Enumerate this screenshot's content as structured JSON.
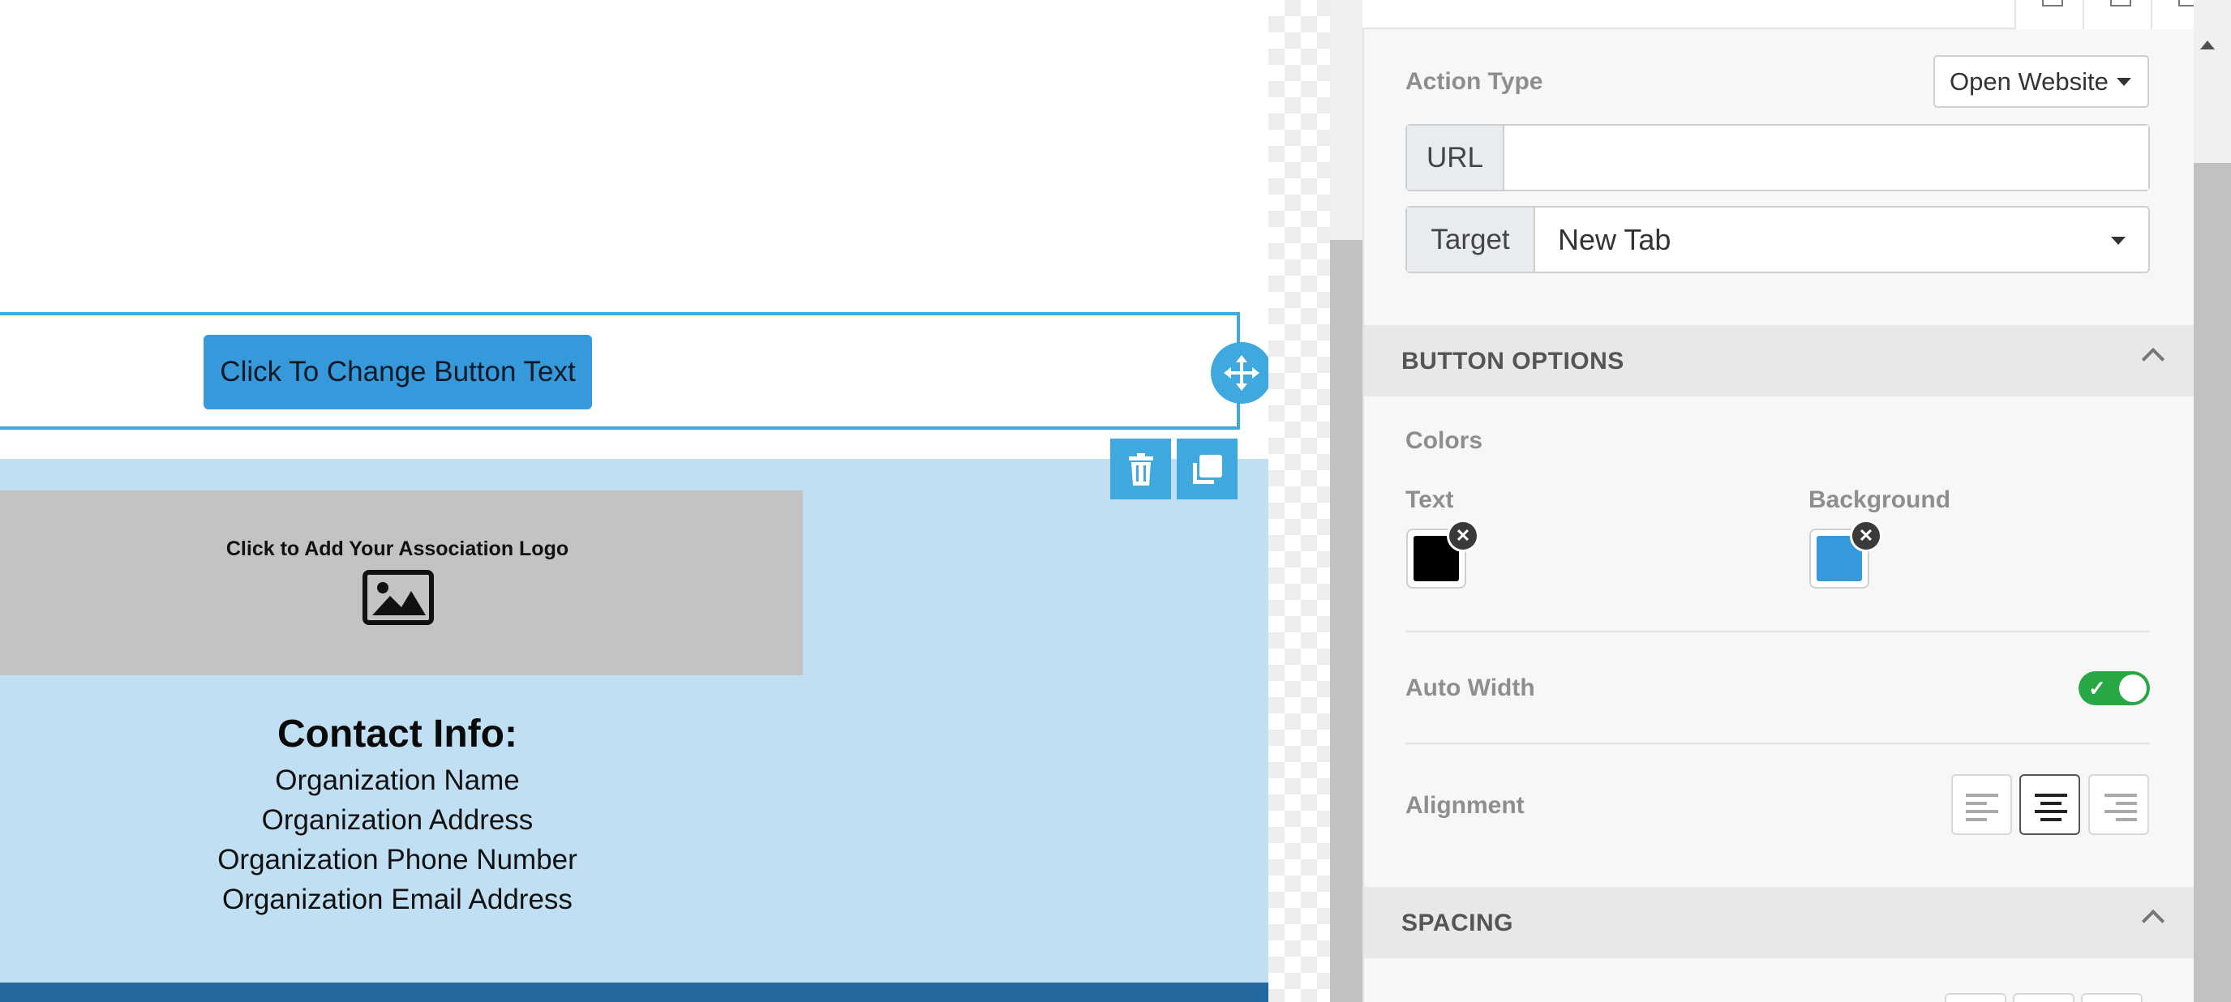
{
  "canvas": {
    "button_text": "Click To Change Button Text",
    "logo_caption": "Click to Add Your Association Logo",
    "contact": {
      "title": "Contact Info:",
      "lines": [
        "Organization Name",
        "Organization Address",
        "Organization Phone Number",
        "Organization Email Address"
      ]
    },
    "colors": {
      "button_bg": "#3599dc",
      "section_bg": "#c1dff2",
      "footer_bg": "#23699f",
      "selection_outline": "#3fa9df"
    }
  },
  "panel": {
    "action_type": {
      "label": "Action Type",
      "value": "Open Website"
    },
    "url": {
      "addon": "URL",
      "value": "",
      "placeholder": ""
    },
    "target": {
      "addon": "Target",
      "value": "New Tab"
    },
    "button_options": {
      "title": "BUTTON OPTIONS",
      "colors_label": "Colors",
      "text_color_label": "Text",
      "text_color": "#000000",
      "background_color_label": "Background",
      "background_color": "#3599dc",
      "auto_width_label": "Auto Width",
      "auto_width_on": true,
      "alignment_label": "Alignment",
      "alignment_options": [
        "left",
        "center",
        "right"
      ],
      "alignment_value": "center"
    },
    "spacing": {
      "title": "SPACING"
    }
  },
  "icons": {
    "move": "move-arrows-icon",
    "delete": "trash-icon",
    "duplicate": "copy-icon",
    "image": "image-icon",
    "clear": "close-icon",
    "check": "check-icon",
    "chevron": "chevron-up-icon"
  }
}
